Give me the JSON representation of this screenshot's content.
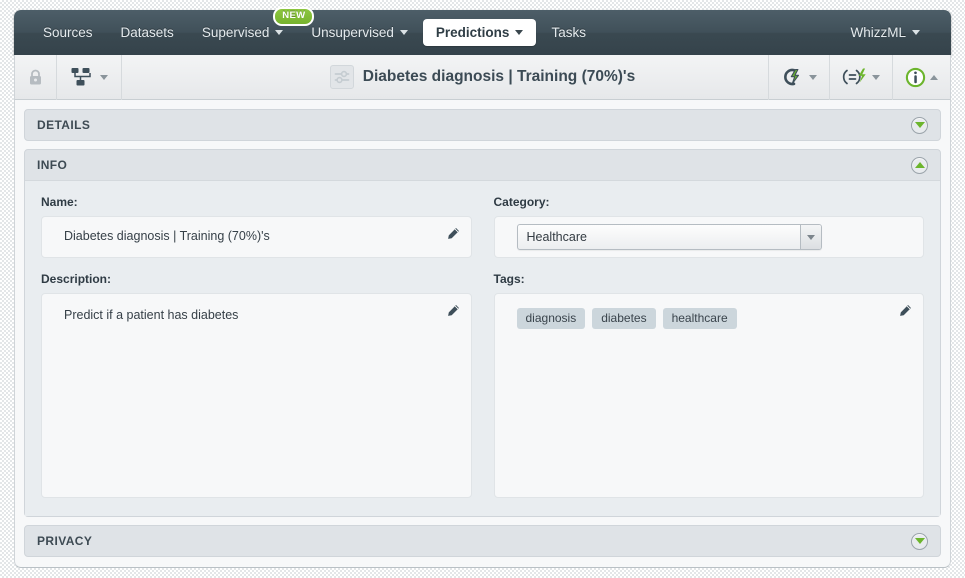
{
  "nav": {
    "items": [
      {
        "label": "Sources",
        "icon": "none",
        "dropdown": false,
        "active": false,
        "badge": null
      },
      {
        "label": "Datasets",
        "icon": "none",
        "dropdown": false,
        "active": false,
        "badge": null
      },
      {
        "label": "Supervised",
        "icon": "chevron-down-icon",
        "dropdown": true,
        "active": false,
        "badge": "NEW"
      },
      {
        "label": "Unsupervised",
        "icon": "chevron-down-icon",
        "dropdown": true,
        "active": false,
        "badge": null
      },
      {
        "label": "Predictions",
        "icon": "chevron-down-icon",
        "dropdown": true,
        "active": true,
        "badge": null
      },
      {
        "label": "Tasks",
        "icon": "none",
        "dropdown": false,
        "active": false,
        "badge": null
      }
    ],
    "account": {
      "label": "WhizzML",
      "icon": "chevron-down-icon"
    }
  },
  "toolbar": {
    "lock_icon": "lock-icon",
    "model_icon": "decision-tree-icon",
    "title": "Diabetes diagnosis | Training (70%)'s",
    "title_icon": "sliders-configure-icon",
    "actions": [
      {
        "name": "batch-prediction-icon",
        "glyph": "C-lightning"
      },
      {
        "name": "evaluation-icon",
        "glyph": "equals-lightning"
      },
      {
        "name": "info-icon",
        "glyph": "info-circle"
      }
    ]
  },
  "panels": {
    "details": {
      "title": "DETAILS",
      "state": "collapsed",
      "toggle_icon": "chevron-down-icon"
    },
    "info": {
      "title": "INFO",
      "state": "expanded",
      "toggle_icon": "chevron-up-icon"
    },
    "privacy": {
      "title": "PRIVACY",
      "state": "collapsed",
      "toggle_icon": "chevron-down-icon"
    }
  },
  "info": {
    "name": {
      "label": "Name:",
      "value": "Diabetes diagnosis | Training (70%)'s",
      "edit_icon": "pencil-icon"
    },
    "category": {
      "label": "Category:",
      "value": "Healthcare",
      "dropdown_icon": "chevron-down-icon"
    },
    "description": {
      "label": "Description:",
      "value": "Predict if a patient has diabetes",
      "edit_icon": "pencil-icon"
    },
    "tags": {
      "label": "Tags:",
      "values": [
        "diagnosis",
        "diabetes",
        "healthcare"
      ],
      "edit_icon": "pencil-icon"
    }
  },
  "colors": {
    "navbar": "#3d4c55",
    "accent_green": "#6cb52d",
    "badge_green": "#8cc63f",
    "panel_header": "#dfe3e7",
    "panel_body": "#e9edf0",
    "title_text": "#3c4b55"
  }
}
